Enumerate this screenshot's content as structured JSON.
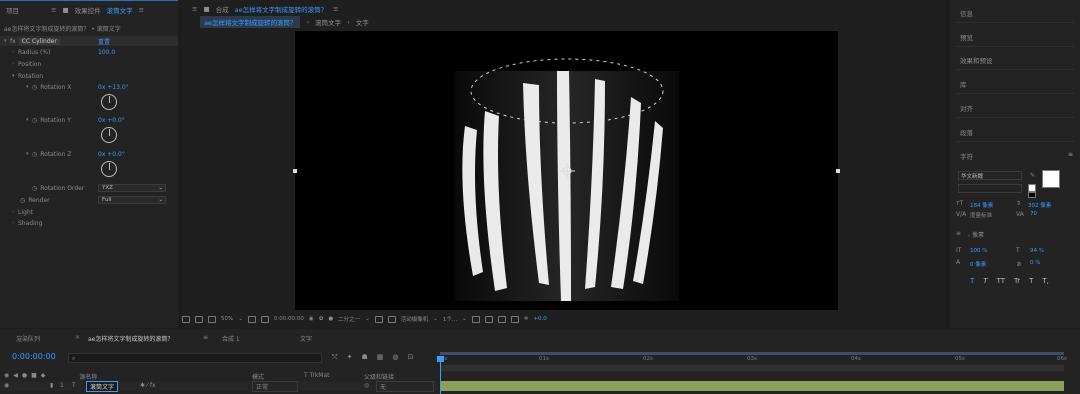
{
  "left_panel": {
    "tabs": {
      "project": "项目",
      "effect_controls": "效果控件",
      "layer_name": "滚筒文字"
    },
    "breadcrumb": "ae怎样将文字制成旋转的滚筒？ • 滚筒文字",
    "effect": {
      "fx": "fx",
      "name": "CC Cylinder",
      "reset": "重置"
    },
    "props": {
      "radius": {
        "label": "Radius (%)",
        "value": "100.0"
      },
      "position": {
        "label": "Position"
      },
      "rotation": {
        "label": "Rotation"
      },
      "rot_x": {
        "label": "Rotation X",
        "value": "0x +13.0°"
      },
      "rot_y": {
        "label": "Rotation Y",
        "value": "0x +0.0°"
      },
      "rot_z": {
        "label": "Rotation Z",
        "value": "0x +0.0°"
      },
      "rot_order": {
        "label": "Rotation Order",
        "value": "YXZ"
      },
      "render": {
        "label": "Render",
        "value": "Full"
      },
      "light": {
        "label": "Light"
      },
      "shading": {
        "label": "Shading"
      }
    }
  },
  "viewer": {
    "tabs": {
      "comp_prefix": "合成",
      "comp_name": "ae怎样将文字制成旋转的滚筒？",
      "tab1": "ae怎样将文字制成旋转的滚筒？",
      "tab2": "滚筒文字",
      "tab3": "文字"
    },
    "toolbar": {
      "zoom": "50%",
      "timecode": "0:00:00:00",
      "resolution": "二分之一",
      "camera": "活动摄像机",
      "views": "1个...",
      "exposure": "+0.0"
    }
  },
  "right_panel": {
    "sections": [
      "信息",
      "预览",
      "效果和预设",
      "库",
      "对齐",
      "段落",
      "字符"
    ],
    "character": {
      "font": "华文新魏",
      "size": "184 像素",
      "leading": "302 像素",
      "tracking_label": "度量标准",
      "tracking": "70",
      "stroke": "- 像素",
      "vscale": "100 %",
      "hscale": "94 %",
      "baseline": "0 像素",
      "tsume": "0 %",
      "styles": [
        "T",
        "T",
        "TT",
        "Tr",
        "T",
        "T,"
      ]
    }
  },
  "timeline": {
    "tabs": {
      "render_queue": "渲染队列",
      "comp1": "ae怎样将文字制成旋转的滚筒？",
      "comp2": "合成 1",
      "comp3": "文字"
    },
    "timecode": "0:00:00:00",
    "search_placeholder": "",
    "columns": {
      "source_name": "源名称",
      "mode": "模式",
      "trk": "T  TrkMat",
      "parent": "父级和链接"
    },
    "layer": {
      "index": "1",
      "name": "滚筒文字",
      "mode": "正常",
      "parent": "无"
    },
    "ruler": [
      "0s",
      "01s",
      "02s",
      "03s",
      "04s",
      "05s",
      "06s"
    ]
  },
  "colors": {
    "accent": "#3b9bff",
    "canvas": "#000000",
    "layer_bar": "#8ba05a"
  }
}
